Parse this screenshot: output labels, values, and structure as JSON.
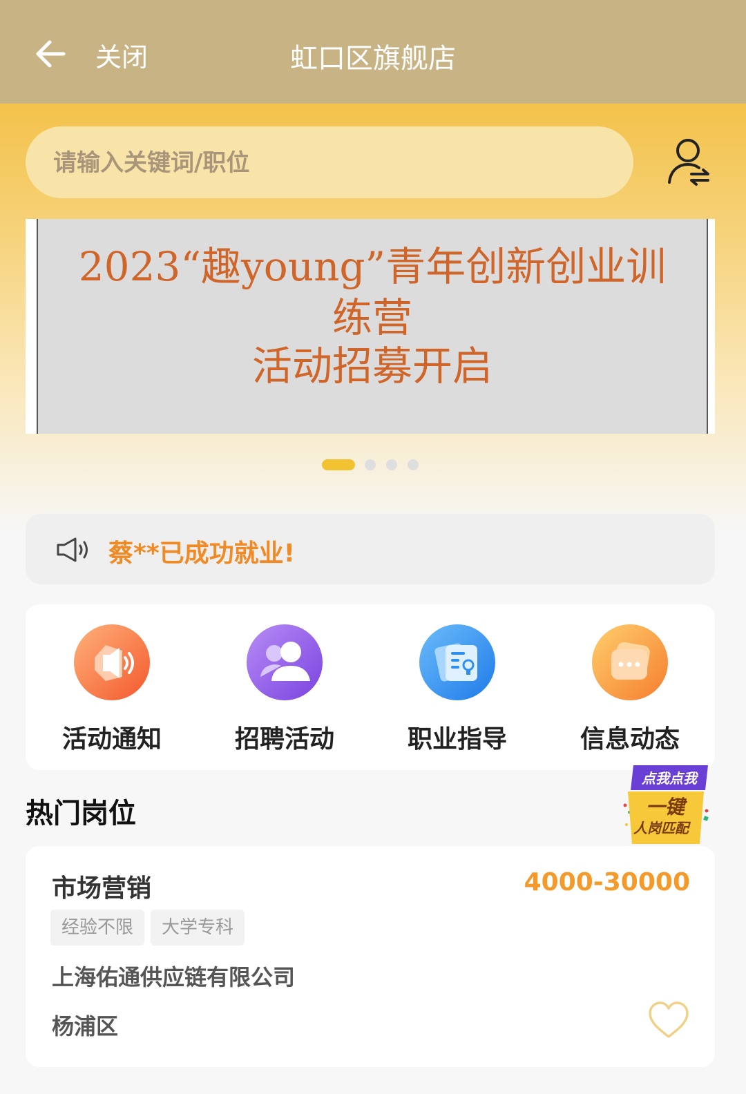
{
  "topbar": {
    "close_label": "关闭",
    "title": "虹口区旗舰店",
    "back_icon": "arrow-left-icon"
  },
  "search": {
    "placeholder": "请输入关键词/职位",
    "switch_icon": "switch-user-icon"
  },
  "banner": {
    "lines": [
      "2023“趣young”青年创新创业训",
      "练营",
      "活动招募开启"
    ],
    "dots": {
      "total": 4,
      "active_index": 0
    }
  },
  "notice": {
    "icon": "speaker-icon",
    "text": "蔡**已成功就业!"
  },
  "menu": {
    "items": [
      {
        "label": "活动通知",
        "icon": "megaphone-icon",
        "color": "#f5733a"
      },
      {
        "label": "招聘活动",
        "icon": "people-icon",
        "color": "#8f5ee8"
      },
      {
        "label": "职业指导",
        "icon": "guide-icon",
        "color": "#2e8df0"
      },
      {
        "label": "信息动态",
        "icon": "message-icon",
        "color": "#f7a233"
      }
    ]
  },
  "hot_jobs": {
    "title": "热门岗位",
    "match_badge": {
      "line1": "点我点我",
      "line2": "一键",
      "line3": "人岗匹配"
    },
    "jobs": [
      {
        "title": "市场营销",
        "salary": "4000-30000",
        "tags": [
          "经验不限",
          "大学专科"
        ],
        "company": "上海佑通供应链有限公司",
        "district": "杨浦区",
        "favorite_icon": "heart-icon"
      }
    ]
  },
  "colors": {
    "topbar": "#c8b385",
    "accent_orange": "#f08a24",
    "salary": "#f39a2b",
    "dot_active": "#f2c230"
  }
}
